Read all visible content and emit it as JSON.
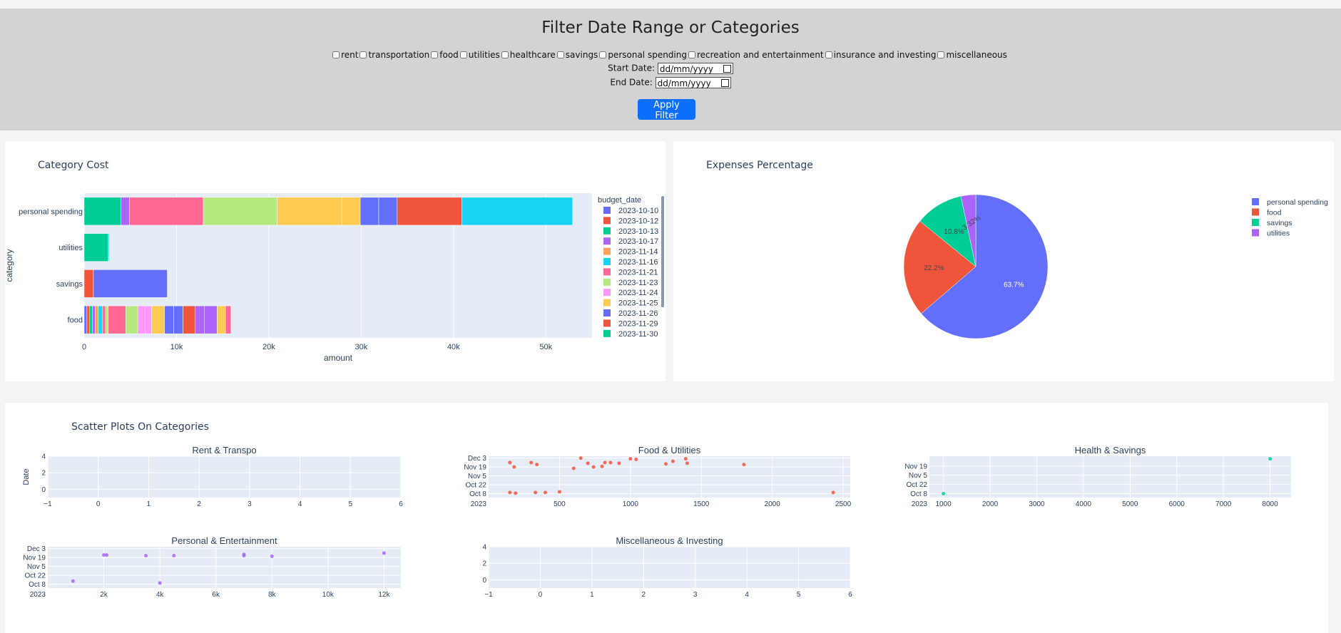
{
  "header": {
    "title": "Filter Date Range or Categories",
    "categories": [
      "rent",
      "transportation",
      "food",
      "utilities",
      "healthcare",
      "savings",
      "personal spending",
      "recreation and entertainment",
      "insurance and investing",
      "miscellaneous"
    ],
    "start_label": "Start Date:",
    "end_label": "End Date:",
    "date_placeholder": "dd/mm/yyyy",
    "apply_label": "Apply Filter",
    "apply_color": "#0d6efd"
  },
  "bar_panel": {
    "title": "Category Cost",
    "legend_title": "budget_date",
    "legend": [
      "2023-10-10",
      "2023-10-12",
      "2023-10-13",
      "2023-10-17",
      "2023-11-14",
      "2023-11-16",
      "2023-11-21",
      "2023-11-23",
      "2023-11-24",
      "2023-11-25",
      "2023-11-26",
      "2023-11-29",
      "2023-11-30"
    ]
  },
  "pie_panel": {
    "title": "Expenses Percentage",
    "legend": [
      "personal spending",
      "food",
      "savings",
      "utilities"
    ]
  },
  "scatter_panel": {
    "title": "Scatter Plots On Categories"
  },
  "chart_data": [
    {
      "type": "bar",
      "orientation": "horizontal",
      "stacked": true,
      "title": "Category Cost",
      "xlabel": "amount",
      "ylabel": "category",
      "categories": [
        "personal spending",
        "utilities",
        "savings",
        "food"
      ],
      "xlim": [
        0,
        55000
      ],
      "xticks": [
        "0",
        "10k",
        "20k",
        "30k",
        "40k",
        "50k"
      ],
      "legend_title": "budget_date",
      "totals": [
        53000,
        2700,
        9000,
        18400
      ],
      "segments": [
        [
          [
            4000,
            "#00cc96"
          ],
          [
            900,
            "#ab63fa"
          ],
          [
            8000,
            "#ff6692"
          ],
          [
            8000,
            "#b6e880"
          ],
          [
            7000,
            "#fecb52"
          ],
          [
            2000,
            "#fecb52"
          ],
          [
            2000,
            "#636efa"
          ],
          [
            2000,
            "#636efa"
          ],
          [
            7000,
            "#ef553b"
          ],
          [
            12000,
            "#19d3f3"
          ]
        ],
        [
          [
            2600,
            "#00cc96"
          ],
          [
            100,
            "#19d3f3"
          ]
        ],
        [
          [
            1000,
            "#ef553b"
          ],
          [
            8000,
            "#636efa"
          ]
        ],
        [
          [
            300,
            "#636efa"
          ],
          [
            300,
            "#ef553b"
          ],
          [
            300,
            "#00cc96"
          ],
          [
            300,
            "#ab63fa"
          ],
          [
            300,
            "#ffa15a"
          ],
          [
            500,
            "#19d3f3"
          ],
          [
            300,
            "#ff6692"
          ],
          [
            300,
            "#b6e880"
          ],
          [
            1900,
            "#ff6692"
          ],
          [
            1300,
            "#b6e880"
          ],
          [
            800,
            "#ff97ff"
          ],
          [
            700,
            "#ff97ff"
          ],
          [
            1400,
            "#fecb52"
          ],
          [
            1000,
            "#636efa"
          ],
          [
            1000,
            "#636efa"
          ],
          [
            1300,
            "#ef553b"
          ],
          [
            1000,
            "#ab63fa"
          ],
          [
            1400,
            "#ab63fa"
          ],
          [
            900,
            "#fecb52"
          ],
          [
            600,
            "#ff6692"
          ]
        ]
      ],
      "legend": [
        [
          "2023-10-10",
          "#636efa"
        ],
        [
          "2023-10-12",
          "#ef553b"
        ],
        [
          "2023-10-13",
          "#00cc96"
        ],
        [
          "2023-10-17",
          "#ab63fa"
        ],
        [
          "2023-11-14",
          "#ffa15a"
        ],
        [
          "2023-11-16",
          "#19d3f3"
        ],
        [
          "2023-11-21",
          "#ff6692"
        ],
        [
          "2023-11-23",
          "#b6e880"
        ],
        [
          "2023-11-24",
          "#ff97ff"
        ],
        [
          "2023-11-25",
          "#fecb52"
        ],
        [
          "2023-11-26",
          "#636efa"
        ],
        [
          "2023-11-29",
          "#ef553b"
        ],
        [
          "2023-11-30",
          "#00cc96"
        ]
      ]
    },
    {
      "type": "pie",
      "title": "Expenses Percentage",
      "labels": [
        "personal spending",
        "food",
        "savings",
        "utilities"
      ],
      "values": [
        63.7,
        22.2,
        10.8,
        3.32
      ],
      "text": [
        "63.7%",
        "22.2%",
        "10.8%",
        "3.32%"
      ],
      "colors": [
        "#636efa",
        "#ef553b",
        "#00cc96",
        "#ab63fa"
      ]
    },
    {
      "type": "scatter",
      "title": "Rent & Transpo",
      "ylabel": "Date",
      "xlim": [
        -1,
        6
      ],
      "ylim": [
        -1,
        4
      ],
      "xticks": [
        [
          -1,
          "−1"
        ],
        [
          0,
          "0"
        ],
        [
          1,
          "1"
        ],
        [
          2,
          "2"
        ],
        [
          3,
          "3"
        ],
        [
          4,
          "4"
        ],
        [
          5,
          "5"
        ],
        [
          6,
          "6"
        ]
      ],
      "yticks": [
        [
          0,
          "0"
        ],
        [
          2,
          "2"
        ],
        [
          4,
          "4"
        ]
      ],
      "points": []
    },
    {
      "type": "scatter",
      "title": "Food & Utilities",
      "color": "#ef553b",
      "xlim": [
        0,
        2550
      ],
      "ylim": [
        "2023-10-02",
        "2023-12-06"
      ],
      "xticks": [
        [
          500,
          "500"
        ],
        [
          1000,
          "1000"
        ],
        [
          1500,
          "1500"
        ],
        [
          2000,
          "2000"
        ],
        [
          2500,
          "2500"
        ]
      ],
      "yticks": [
        [
          "2023-12-03",
          "Dec 3"
        ],
        [
          "2023-11-19",
          "Nov 19"
        ],
        [
          "2023-11-05",
          "Nov 5"
        ],
        [
          "2023-10-22",
          "Oct 22"
        ],
        [
          "2023-10-08",
          "Oct 8"
        ]
      ],
      "y_year": "2023",
      "points": [
        [
          150,
          "2023-10-10"
        ],
        [
          190,
          "2023-10-09"
        ],
        [
          150,
          "2023-11-26"
        ],
        [
          180,
          "2023-11-19"
        ],
        [
          300,
          "2023-11-26"
        ],
        [
          340,
          "2023-11-23"
        ],
        [
          330,
          "2023-10-10"
        ],
        [
          400,
          "2023-10-10"
        ],
        [
          500,
          "2023-10-11"
        ],
        [
          600,
          "2023-11-17"
        ],
        [
          650,
          "2023-12-03"
        ],
        [
          700,
          "2023-11-25"
        ],
        [
          740,
          "2023-11-19"
        ],
        [
          800,
          "2023-11-20"
        ],
        [
          820,
          "2023-11-26"
        ],
        [
          860,
          "2023-11-26"
        ],
        [
          920,
          "2023-11-25"
        ],
        [
          1000,
          "2023-12-02"
        ],
        [
          1040,
          "2023-12-01"
        ],
        [
          1250,
          "2023-11-24"
        ],
        [
          1300,
          "2023-11-28"
        ],
        [
          1390,
          "2023-12-02"
        ],
        [
          1400,
          "2023-11-25"
        ],
        [
          1800,
          "2023-11-23"
        ],
        [
          2430,
          "2023-10-10"
        ]
      ]
    },
    {
      "type": "scatter",
      "title": "Health & Savings",
      "color": "#00cc96",
      "xlim": [
        700,
        8450
      ],
      "ylim": [
        "2023-10-02",
        "2023-12-04"
      ],
      "xticks": [
        [
          1000,
          "1000"
        ],
        [
          2000,
          "2000"
        ],
        [
          3000,
          "3000"
        ],
        [
          4000,
          "4000"
        ],
        [
          5000,
          "5000"
        ],
        [
          6000,
          "6000"
        ],
        [
          7000,
          "7000"
        ],
        [
          8000,
          "8000"
        ]
      ],
      "yticks": [
        [
          "2023-11-19",
          "Nov 19"
        ],
        [
          "2023-11-05",
          "Nov 5"
        ],
        [
          "2023-10-22",
          "Oct 22"
        ],
        [
          "2023-10-08",
          "Oct 8"
        ]
      ],
      "y_year": "2023",
      "points": [
        [
          1000,
          "2023-10-08"
        ],
        [
          8000,
          "2023-11-30"
        ]
      ]
    },
    {
      "type": "scatter",
      "title": "Personal & Entertainment",
      "color": "#ab63fa",
      "xlim": [
        0,
        12600
      ],
      "ylim": [
        "2023-10-02",
        "2023-12-06"
      ],
      "xticks": [
        [
          2000,
          "2k"
        ],
        [
          4000,
          "4k"
        ],
        [
          6000,
          "6k"
        ],
        [
          8000,
          "8k"
        ],
        [
          10000,
          "10k"
        ],
        [
          12000,
          "12k"
        ]
      ],
      "yticks": [
        [
          "2023-12-03",
          "Dec 3"
        ],
        [
          "2023-11-19",
          "Nov 19"
        ],
        [
          "2023-11-05",
          "Nov 5"
        ],
        [
          "2023-10-22",
          "Oct 22"
        ],
        [
          "2023-10-08",
          "Oct 8"
        ]
      ],
      "y_year": "2023",
      "points": [
        [
          900,
          "2023-10-13"
        ],
        [
          2000,
          "2023-11-23"
        ],
        [
          2100,
          "2023-11-23"
        ],
        [
          3500,
          "2023-11-22"
        ],
        [
          4000,
          "2023-10-10"
        ],
        [
          4500,
          "2023-11-22"
        ],
        [
          7000,
          "2023-11-24"
        ],
        [
          7000,
          "2023-11-22"
        ],
        [
          8000,
          "2023-11-21"
        ],
        [
          12000,
          "2023-11-26"
        ]
      ]
    },
    {
      "type": "scatter",
      "title": "Miscellaneous & Investing",
      "xlim": [
        -1,
        6
      ],
      "ylim": [
        -1,
        4
      ],
      "xticks": [
        [
          -1,
          "−1"
        ],
        [
          0,
          "0"
        ],
        [
          1,
          "1"
        ],
        [
          2,
          "2"
        ],
        [
          3,
          "3"
        ],
        [
          4,
          "4"
        ],
        [
          5,
          "5"
        ],
        [
          6,
          "6"
        ]
      ],
      "yticks": [
        [
          0,
          "0"
        ],
        [
          2,
          "2"
        ],
        [
          4,
          "4"
        ]
      ],
      "points": []
    }
  ]
}
